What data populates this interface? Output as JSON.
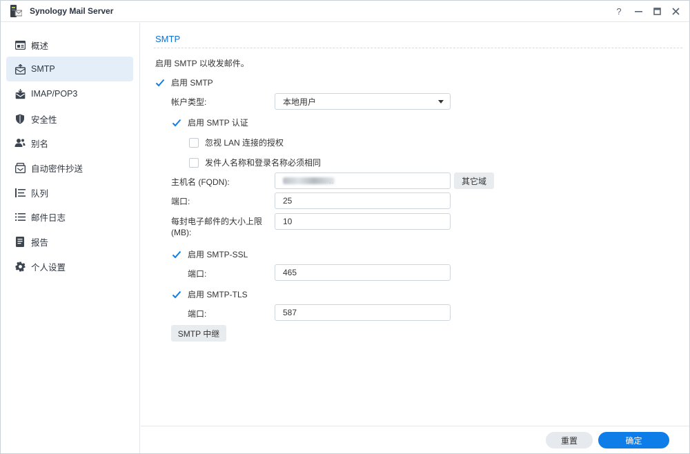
{
  "window": {
    "title": "Synology Mail Server",
    "buttons": {
      "help": "?",
      "minimize": "–",
      "maximize": "□",
      "close": "✕"
    }
  },
  "sidebar": {
    "items": [
      {
        "label": "概述",
        "icon": "overview-icon"
      },
      {
        "label": "SMTP",
        "icon": "smtp-icon",
        "active": true
      },
      {
        "label": "IMAP/POP3",
        "icon": "imap-icon"
      },
      {
        "label": "安全性",
        "icon": "shield-icon"
      },
      {
        "label": "别名",
        "icon": "users-icon"
      },
      {
        "label": "自动密件抄送",
        "icon": "bcc-icon"
      },
      {
        "label": "队列",
        "icon": "queue-icon"
      },
      {
        "label": "邮件日志",
        "icon": "list-icon"
      },
      {
        "label": "报告",
        "icon": "report-icon"
      },
      {
        "label": "个人设置",
        "icon": "gear-icon"
      }
    ]
  },
  "main": {
    "section_title": "SMTP",
    "description": "启用 SMTP 以收发邮件。",
    "enable_smtp": {
      "label": "启用 SMTP",
      "checked": true
    },
    "account_type": {
      "label": "帐户类型:",
      "value": "本地用户"
    },
    "enable_smtp_auth": {
      "label": "启用 SMTP 认证",
      "checked": true
    },
    "ignore_lan_auth": {
      "label": "忽视 LAN 连接的授权",
      "checked": false
    },
    "sender_match": {
      "label": "发件人名称和登录名称必须相同",
      "checked": false
    },
    "hostname": {
      "label": "主机名 (FQDN):",
      "value_suffix": "r.",
      "button": "其它域"
    },
    "port": {
      "label": "端口:",
      "value": "25"
    },
    "max_size": {
      "label": "每封电子邮件的大小上限 (MB):",
      "value": "10"
    },
    "smtp_ssl": {
      "label": "启用 SMTP-SSL",
      "checked": true,
      "port_label": "端口:",
      "port": "465"
    },
    "smtp_tls": {
      "label": "启用 SMTP-TLS",
      "checked": true,
      "port_label": "端口:",
      "port": "587"
    },
    "relay_button": "SMTP 中继"
  },
  "footer": {
    "reset": "重置",
    "ok": "确定"
  },
  "colors": {
    "accent": "#0f7de8",
    "active_bg": "#e3eef9",
    "section_title": "#0b6fd0"
  }
}
